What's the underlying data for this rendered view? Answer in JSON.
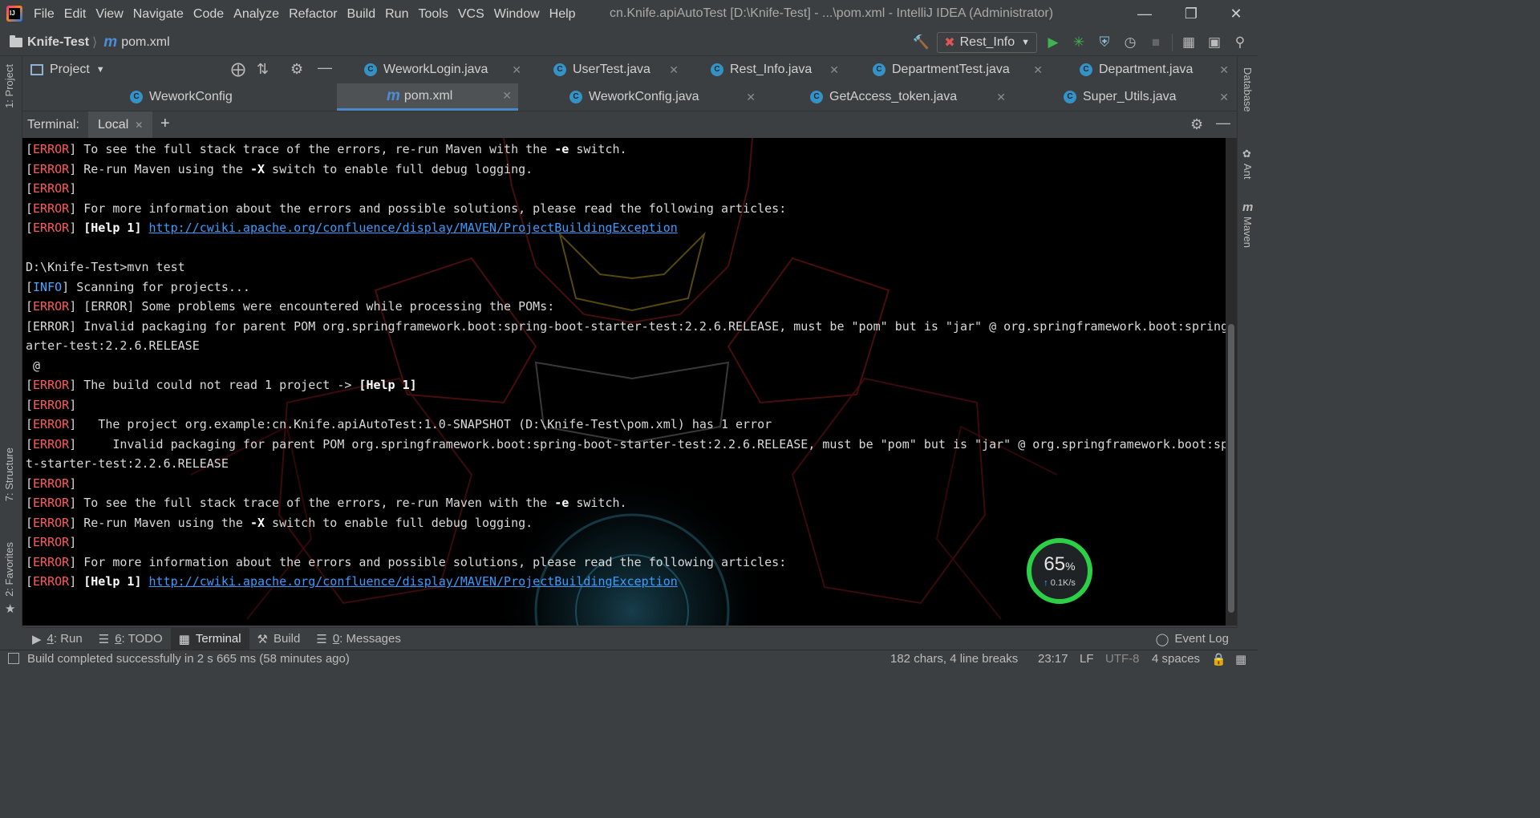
{
  "menu": {
    "items": [
      "File",
      "Edit",
      "View",
      "Navigate",
      "Code",
      "Analyze",
      "Refactor",
      "Build",
      "Run",
      "Tools",
      "VCS",
      "Window",
      "Help"
    ],
    "window_title": "cn.Knife.apiAutoTest [D:\\Knife-Test] - ...\\pom.xml - IntelliJ IDEA (Administrator)"
  },
  "navbar": {
    "project": "Knife-Test",
    "file": "pom.xml",
    "run_config": "Rest_Info"
  },
  "project_panel": {
    "title": "Project"
  },
  "editor_tabs": {
    "row1": [
      {
        "label": "WeworkLogin.java",
        "icon": "java-class-icon"
      },
      {
        "label": "UserTest.java",
        "icon": "java-class-icon"
      },
      {
        "label": "Rest_Info.java",
        "icon": "java-class-icon"
      },
      {
        "label": "DepartmentTest.java",
        "icon": "java-class-icon"
      },
      {
        "label": "Department.java",
        "icon": "java-class-icon"
      }
    ],
    "row2": [
      {
        "label": "WeworkConfig",
        "icon": "java-class-icon"
      },
      {
        "label": "pom.xml",
        "icon": "maven-icon"
      },
      {
        "label": "WeworkConfig.java",
        "icon": "java-class-icon"
      },
      {
        "label": "GetAccess_token.java",
        "icon": "java-class-icon"
      },
      {
        "label": "Super_Utils.java",
        "icon": "java-class-icon"
      }
    ],
    "active": "pom.xml"
  },
  "terminal": {
    "title": "Terminal:",
    "session_tab": "Local",
    "lines": [
      [
        {
          "t": "["
        },
        {
          "t": "ERROR",
          "c": "err"
        },
        {
          "t": "] To see the full stack trace of the errors, re-run Maven with the "
        },
        {
          "t": "-e",
          "c": "bold"
        },
        {
          "t": " switch."
        }
      ],
      [
        {
          "t": "["
        },
        {
          "t": "ERROR",
          "c": "err"
        },
        {
          "t": "] Re-run Maven using the "
        },
        {
          "t": "-X",
          "c": "bold"
        },
        {
          "t": " switch to enable full debug logging."
        }
      ],
      [
        {
          "t": "["
        },
        {
          "t": "ERROR",
          "c": "err"
        },
        {
          "t": "]"
        }
      ],
      [
        {
          "t": "["
        },
        {
          "t": "ERROR",
          "c": "err"
        },
        {
          "t": "] For more information about the errors and possible solutions, please read the following articles:"
        }
      ],
      [
        {
          "t": "["
        },
        {
          "t": "ERROR",
          "c": "err"
        },
        {
          "t": "] "
        },
        {
          "t": "[Help 1]",
          "c": "bold"
        },
        {
          "t": " "
        },
        {
          "t": "http://cwiki.apache.org/confluence/display/MAVEN/ProjectBuildingException",
          "c": "link"
        }
      ],
      [
        {
          "t": ""
        }
      ],
      [
        {
          "t": "D:\\Knife-Test>mvn test"
        }
      ],
      [
        {
          "t": "["
        },
        {
          "t": "INFO",
          "c": "info"
        },
        {
          "t": "] Scanning for projects..."
        }
      ],
      [
        {
          "t": "["
        },
        {
          "t": "ERROR",
          "c": "err"
        },
        {
          "t": "] [ERROR] Some problems were encountered while processing the POMs:"
        }
      ],
      [
        {
          "t": "[ERROR] Invalid packaging for parent POM org.springframework.boot:spring-boot-starter-test:2.2.6.RELEASE, must be \"pom\" but is \"jar\" @ org.springframework.boot:spring-boot-st"
        }
      ],
      [
        {
          "t": "arter-test:2.2.6.RELEASE"
        }
      ],
      [
        {
          "t": " @"
        }
      ],
      [
        {
          "t": "["
        },
        {
          "t": "ERROR",
          "c": "err"
        },
        {
          "t": "] The build could not read 1 project -> "
        },
        {
          "t": "[Help 1]",
          "c": "bold"
        }
      ],
      [
        {
          "t": "["
        },
        {
          "t": "ERROR",
          "c": "err"
        },
        {
          "t": "]"
        }
      ],
      [
        {
          "t": "["
        },
        {
          "t": "ERROR",
          "c": "err"
        },
        {
          "t": "]   The project org.example:cn.Knife.apiAutoTest:1.0-SNAPSHOT (D:\\Knife-Test\\pom.xml) has 1 error"
        }
      ],
      [
        {
          "t": "["
        },
        {
          "t": "ERROR",
          "c": "err"
        },
        {
          "t": "]     Invalid packaging for parent POM org.springframework.boot:spring-boot-starter-test:2.2.6.RELEASE, must be \"pom\" but is \"jar\" @ org.springframework.boot:spring-boo"
        }
      ],
      [
        {
          "t": "t-starter-test:2.2.6.RELEASE"
        }
      ],
      [
        {
          "t": "["
        },
        {
          "t": "ERROR",
          "c": "err"
        },
        {
          "t": "]"
        }
      ],
      [
        {
          "t": "["
        },
        {
          "t": "ERROR",
          "c": "err"
        },
        {
          "t": "] To see the full stack trace of the errors, re-run Maven with the "
        },
        {
          "t": "-e",
          "c": "bold"
        },
        {
          "t": " switch."
        }
      ],
      [
        {
          "t": "["
        },
        {
          "t": "ERROR",
          "c": "err"
        },
        {
          "t": "] Re-run Maven using the "
        },
        {
          "t": "-X",
          "c": "bold"
        },
        {
          "t": " switch to enable full debug logging."
        }
      ],
      [
        {
          "t": "["
        },
        {
          "t": "ERROR",
          "c": "err"
        },
        {
          "t": "]"
        }
      ],
      [
        {
          "t": "["
        },
        {
          "t": "ERROR",
          "c": "err"
        },
        {
          "t": "] For more information about the errors and possible solutions, please read the following articles:"
        }
      ],
      [
        {
          "t": "["
        },
        {
          "t": "ERROR",
          "c": "err"
        },
        {
          "t": "] "
        },
        {
          "t": "[Help 1]",
          "c": "bold"
        },
        {
          "t": " "
        },
        {
          "t": "http://cwiki.apache.org/confluence/display/MAVEN/ProjectBuildingException",
          "c": "link"
        }
      ]
    ]
  },
  "side_tabs": {
    "left_top": "1: Project",
    "left_structure": "7: Structure",
    "left_favorites": "2: Favorites",
    "right": [
      "Database",
      "Ant",
      "Maven"
    ]
  },
  "net_widget": {
    "percent": "65",
    "percent_sign": "%",
    "speed": "0.1K/s"
  },
  "tool_windows": [
    {
      "key": "4",
      "label": ": Run",
      "icon": "play-icon"
    },
    {
      "key": "6",
      "label": ": TODO",
      "icon": "list-icon"
    },
    {
      "key": "",
      "label": "Terminal",
      "icon": "terminal-icon"
    },
    {
      "key": "",
      "label": "Build",
      "icon": "hammer-icon"
    },
    {
      "key": "0",
      "label": ": Messages",
      "icon": "messages-icon"
    }
  ],
  "event_log": "Event Log",
  "status": {
    "message": "Build completed successfully in 2 s 665 ms (58 minutes ago)",
    "selection": "182 chars, 4 line breaks",
    "position": "23:17",
    "line_sep": "LF",
    "encoding": "UTF-8",
    "indent": "4 spaces"
  },
  "colors": {
    "error": "#ff5a5a",
    "info": "#4aa8ff",
    "link": "#3a9bff",
    "accent": "#4a88c7",
    "run_green": "#3fb34f",
    "widget_ring": "#2bd046"
  }
}
